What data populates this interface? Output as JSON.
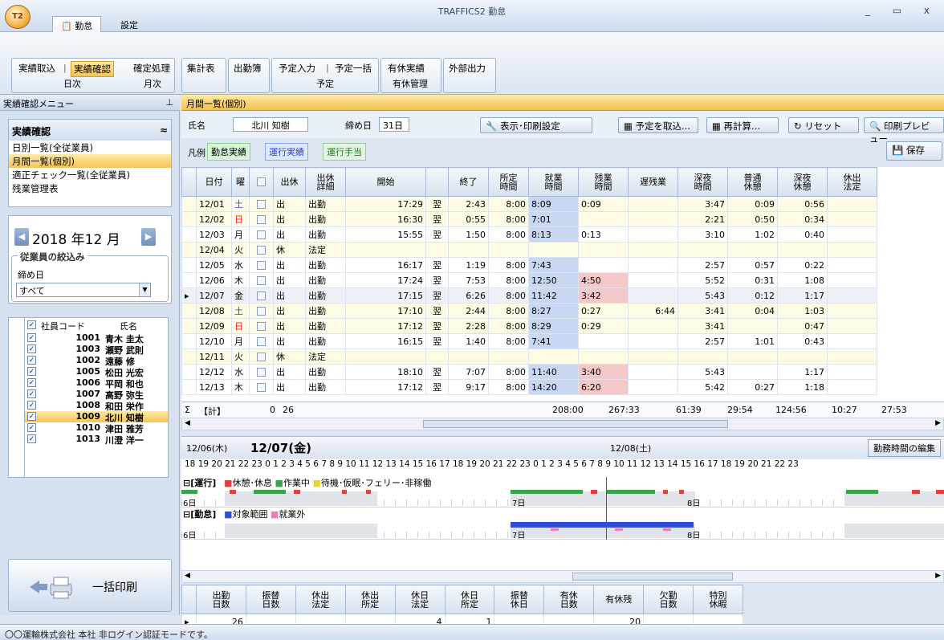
{
  "app": {
    "title": "TRAFFICS2 勤怠",
    "logo": "T2",
    "window_controls": "_ ▭ x"
  },
  "ribbon": {
    "tabs": [
      "勤怠",
      "設定"
    ],
    "groups": [
      {
        "label": "日次",
        "buttons": [
          "実績取込",
          "実績確認"
        ]
      },
      {
        "label": "月次",
        "buttons": [
          "確定処理"
        ]
      },
      {
        "label": "",
        "buttons": [
          "集計表"
        ]
      },
      {
        "label": "",
        "buttons": [
          "出勤簿"
        ]
      },
      {
        "label": "予定",
        "buttons": [
          "予定入力",
          "予定一括"
        ]
      },
      {
        "label": "有休管理",
        "buttons": [
          "有休実績"
        ]
      },
      {
        "label": "",
        "buttons": [
          "外部出力"
        ]
      }
    ]
  },
  "left_panel": {
    "header": "実績確認メニュー",
    "pin": "⊥",
    "menu_title": "実績確認",
    "menu_items": [
      "日別一覧(全従業員)",
      "月間一覧(個別)",
      "適正チェック一覧(全従業員)",
      "残業管理表"
    ],
    "month": "2018 年12 月",
    "filter_title": "従業員の絞込み",
    "shime_label": "締め日",
    "shime_value": "すべて",
    "emp_header": {
      "code": "社員コード",
      "name": "氏名"
    },
    "employees": [
      {
        "code": "1001",
        "name": "青木 圭太"
      },
      {
        "code": "1003",
        "name": "瀬野 武則"
      },
      {
        "code": "1002",
        "name": "遠藤 修"
      },
      {
        "code": "1005",
        "name": "松田 光宏"
      },
      {
        "code": "1006",
        "name": "平岡 和也"
      },
      {
        "code": "1007",
        "name": "高野 弥生"
      },
      {
        "code": "1008",
        "name": "和田 栄作"
      },
      {
        "code": "1009",
        "name": "北川 知樹"
      },
      {
        "code": "1010",
        "name": "津田 雅芳"
      },
      {
        "code": "1013",
        "name": "川澄 洋一"
      }
    ],
    "bulk_print": "一括印刷"
  },
  "main": {
    "header": "月間一覧(個別)",
    "name_label": "氏名",
    "name_value": "北川 知樹",
    "shime_label": "締め日",
    "shime_value": "31日",
    "buttons": {
      "display": "表示･印刷設定",
      "import": "予定を取込...",
      "recalc": "再計算...",
      "reset": "リセット",
      "preview": "印刷プレビュー",
      "save": "保存"
    },
    "legend_label": "凡例",
    "legend": [
      "勤怠実績",
      "運行実績",
      "運行手当"
    ],
    "columns": [
      "日付",
      "曜",
      "",
      "出休",
      "出休\n詳細",
      "開始",
      "",
      "終了",
      "所定\n時間",
      "就業\n時間",
      "残業\n時間",
      "遅残業",
      "深夜\n時間",
      "普通\n休憩",
      "深夜\n休憩",
      "休出\n法定"
    ],
    "rows": [
      [
        "12/01",
        "土",
        "出",
        "出勤",
        "17:29",
        "翌",
        "2:43",
        "8:00",
        "8:09",
        "0:09",
        "",
        "3:47",
        "0:09",
        "0:56"
      ],
      [
        "12/02",
        "日",
        "出",
        "出勤",
        "16:30",
        "翌",
        "0:55",
        "8:00",
        "7:01",
        "",
        "",
        "2:21",
        "0:50",
        "0:34"
      ],
      [
        "12/03",
        "月",
        "出",
        "出勤",
        "15:55",
        "翌",
        "1:50",
        "8:00",
        "8:13",
        "0:13",
        "",
        "3:10",
        "1:02",
        "0:40"
      ],
      [
        "12/04",
        "火",
        "休",
        "法定",
        "",
        "",
        "",
        "",
        "",
        "",
        "",
        "",
        "",
        ""
      ],
      [
        "12/05",
        "水",
        "出",
        "出勤",
        "16:17",
        "翌",
        "1:19",
        "8:00",
        "7:43",
        "",
        "",
        "2:57",
        "0:57",
        "0:22"
      ],
      [
        "12/06",
        "木",
        "出",
        "出勤",
        "17:24",
        "翌",
        "7:53",
        "8:00",
        "12:50",
        "4:50",
        "",
        "5:52",
        "0:31",
        "1:08"
      ],
      [
        "12/07",
        "金",
        "出",
        "出勤",
        "17:15",
        "翌",
        "6:26",
        "8:00",
        "11:42",
        "3:42",
        "",
        "5:43",
        "0:12",
        "1:17"
      ],
      [
        "12/08",
        "土",
        "出",
        "出勤",
        "17:10",
        "翌",
        "2:44",
        "8:00",
        "8:27",
        "0:27",
        "6:44",
        "3:41",
        "0:04",
        "1:03"
      ],
      [
        "12/09",
        "日",
        "出",
        "出勤",
        "17:12",
        "翌",
        "2:28",
        "8:00",
        "8:29",
        "0:29",
        "",
        "3:41",
        "",
        "0:47"
      ],
      [
        "12/10",
        "月",
        "出",
        "出勤",
        "16:15",
        "翌",
        "1:40",
        "8:00",
        "7:41",
        "",
        "",
        "2:57",
        "1:01",
        "0:43"
      ],
      [
        "12/11",
        "火",
        "休",
        "法定",
        "",
        "",
        "",
        "",
        "",
        "",
        "",
        "",
        "",
        ""
      ],
      [
        "12/12",
        "水",
        "出",
        "出勤",
        "18:10",
        "翌",
        "7:07",
        "8:00",
        "11:40",
        "3:40",
        "",
        "5:43",
        "",
        "1:17"
      ],
      [
        "12/13",
        "木",
        "出",
        "出勤",
        "17:12",
        "翌",
        "9:17",
        "8:00",
        "14:20",
        "6:20",
        "",
        "5:42",
        "0:27",
        "1:18"
      ]
    ],
    "totals": {
      "label": "【計】",
      "count0": "0",
      "count": "26",
      "shotei": "208:00",
      "shugyo": "267:33",
      "zangyo": "61:39",
      "chi": "29:54",
      "shinya": "124:56",
      "futsu": "10:27",
      "shinya_k": "27:53"
    },
    "timeline": {
      "prev_date": "12/06(木)",
      "cur_date": "12/07(金)",
      "next_date": "12/08(土)",
      "edit_btn": "勤務時間の編集",
      "ruler": "18 19 20 21 22 23 0  1  2  3  4  5  6  7  8  9  10 11 12 13 14 15 16 17 18 19 20 21 22 23 0  1  2  3  4  5  6  7  8  9  10 11 12 13 14 15 16 17 18 19 20 21 22 23",
      "unkou_title": "[運行]",
      "unkou_legend": [
        "休憩･休息",
        "作業中",
        "待機･仮眠･フェリー･非稼働"
      ],
      "kintai_title": "[勤怠]",
      "kintai_legend": [
        "対象範囲",
        "就業外"
      ],
      "day_labels": [
        "6日",
        "7日",
        "8日"
      ],
      "colors": {
        "rest": "#e04040",
        "work": "#3aa34a",
        "wait": "#e8d338",
        "range": "#2c4fd6",
        "off": "#f07ab8"
      }
    },
    "summary": {
      "headers": [
        "出勤\n日数",
        "振替\n日数",
        "休出\n法定",
        "休出\n所定",
        "休日\n法定",
        "休日\n所定",
        "振替\n休日",
        "有休\n日数",
        "有休残",
        "欠勤\n日数",
        "特別\n休暇"
      ],
      "values": [
        "26",
        "",
        "",
        "",
        "4",
        "1",
        "",
        "",
        "20",
        "",
        ""
      ]
    }
  },
  "status": "〇〇運輸株式会社 本社   非ログイン認証モードです。"
}
